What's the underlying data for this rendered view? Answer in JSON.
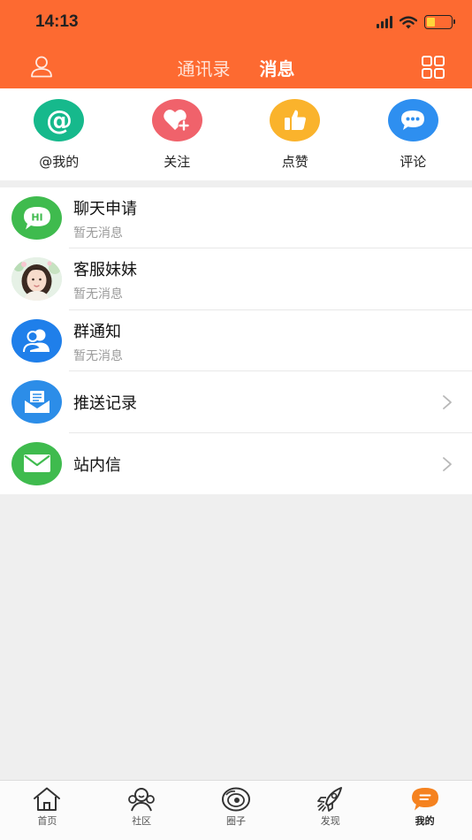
{
  "status_bar": {
    "time": "14:13"
  },
  "header": {
    "tabs": [
      {
        "label": "通讯录",
        "active": false
      },
      {
        "label": "消息",
        "active": true
      }
    ],
    "brand_color": "#fd6a31"
  },
  "quick_actions": [
    {
      "label": "@我的",
      "icon": "at-icon",
      "color": "#16b98c"
    },
    {
      "label": "关注",
      "icon": "heart-plus-icon",
      "color": "#f0626b"
    },
    {
      "label": "点赞",
      "icon": "thumbs-up-icon",
      "color": "#fab32c"
    },
    {
      "label": "评论",
      "icon": "comment-icon",
      "color": "#2e8ff0"
    }
  ],
  "messages": [
    {
      "title": "聊天申请",
      "subtitle": "暂无消息",
      "icon": "hi-chat-icon",
      "color": "#3fbb4e"
    },
    {
      "title": "客服妹妹",
      "subtitle": "暂无消息",
      "icon": "avatar-photo",
      "color": "#dfeee4"
    },
    {
      "title": "群通知",
      "subtitle": "暂无消息",
      "icon": "group-icon",
      "color": "#1f7fea"
    },
    {
      "title": "推送记录",
      "icon": "inbox-icon",
      "color": "#2c8de8",
      "chevron": true
    },
    {
      "title": "站内信",
      "icon": "mail-icon",
      "color": "#3fbb4e",
      "chevron": true
    }
  ],
  "tabbar": [
    {
      "label": "首页",
      "icon": "home-icon",
      "active": false
    },
    {
      "label": "社区",
      "icon": "community-icon",
      "active": false
    },
    {
      "label": "圈子",
      "icon": "circle-icon",
      "active": false
    },
    {
      "label": "发现",
      "icon": "rocket-icon",
      "active": false
    },
    {
      "label": "我的",
      "icon": "chat-menu-icon",
      "active": true,
      "color": "#f5821f"
    }
  ]
}
